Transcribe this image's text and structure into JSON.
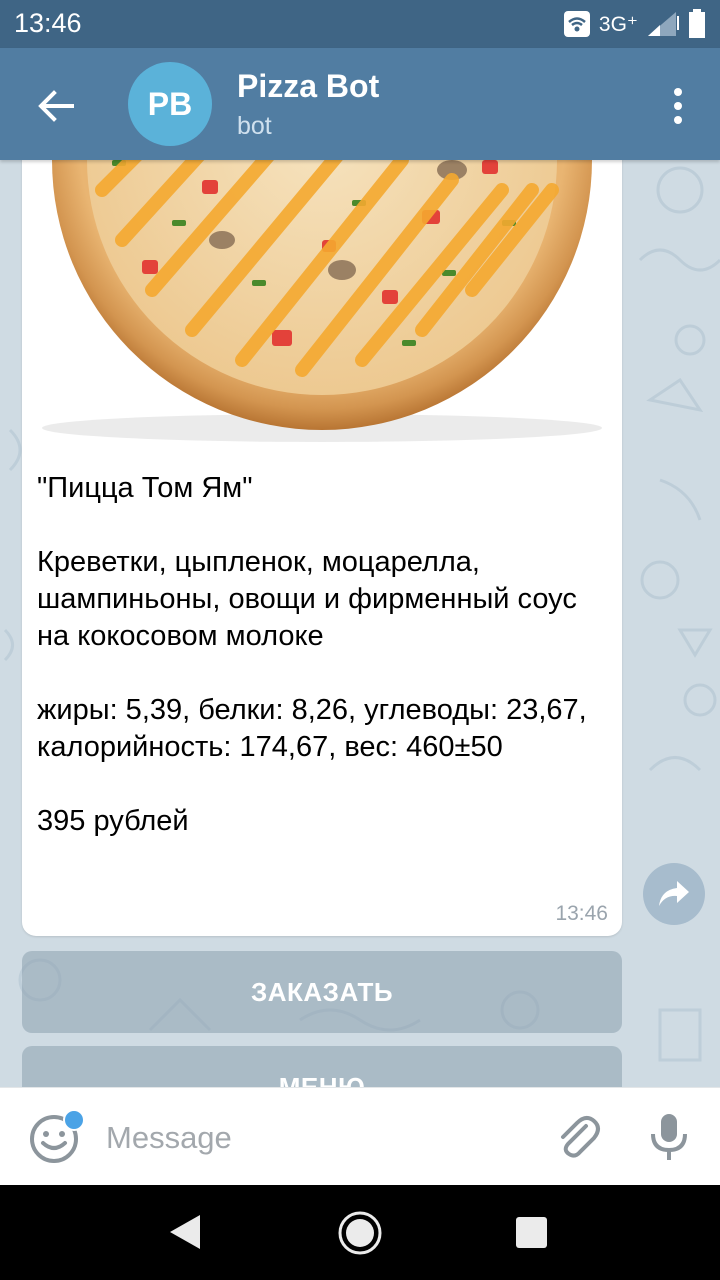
{
  "status_bar": {
    "time": "13:46",
    "network": "3G⁺",
    "icons": [
      "wifi-hotspot-icon",
      "signal-icon",
      "battery-icon"
    ]
  },
  "header": {
    "avatar_initials": "PB",
    "title": "Pizza Bot",
    "subtitle": "bot",
    "colors": {
      "bar": "#517da2",
      "avatar": "#5bb2d9"
    }
  },
  "message": {
    "title": "\"Пицца Том Ям\"",
    "description": "Креветки, цыпленок, моцарелла, шампиньоны, овощи и фирменный соус на кокосовом молоке",
    "nutrition": "жиры: 5,39, белки: 8,26, углеводы: 23,67, калорийность: 174,67, вес: 460±50",
    "price": "395 рублей",
    "time": "13:46",
    "image": "pizza-photo"
  },
  "keyboard": {
    "buttons": [
      {
        "label": "ЗАКАЗАТЬ"
      },
      {
        "label": "МЕНЮ"
      }
    ]
  },
  "input": {
    "placeholder": "Message",
    "value": ""
  }
}
